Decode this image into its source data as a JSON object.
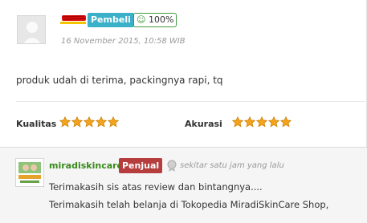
{
  "review": {
    "username_redacted": "",
    "buyer_badge": "Pembeli",
    "reputation": "100%",
    "reputation_icon": "smile-icon",
    "timestamp": "16 November 2015, 10:58 WIB",
    "text": "produk udah di terima, packingnya rapi, tq",
    "ratings": {
      "quality_label": "Kualitas",
      "quality_stars": 5,
      "accuracy_label": "Akurasi",
      "accuracy_stars": 5
    }
  },
  "reply": {
    "seller_name": "miradiskincare",
    "seller_badge": "Penjual",
    "time": "sekitar satu jam yang lalu",
    "lines": [
      "Terimakasih sis atas review dan bintangnya....",
      "Terimakasih telah belanja di Tokopedia MiradiSkinCare Shop,"
    ]
  },
  "colors": {
    "buyer_badge": "#3bb0c9",
    "seller_badge": "#b53d3d",
    "seller_name": "#3a8a1c",
    "star": "#f4a31a"
  }
}
